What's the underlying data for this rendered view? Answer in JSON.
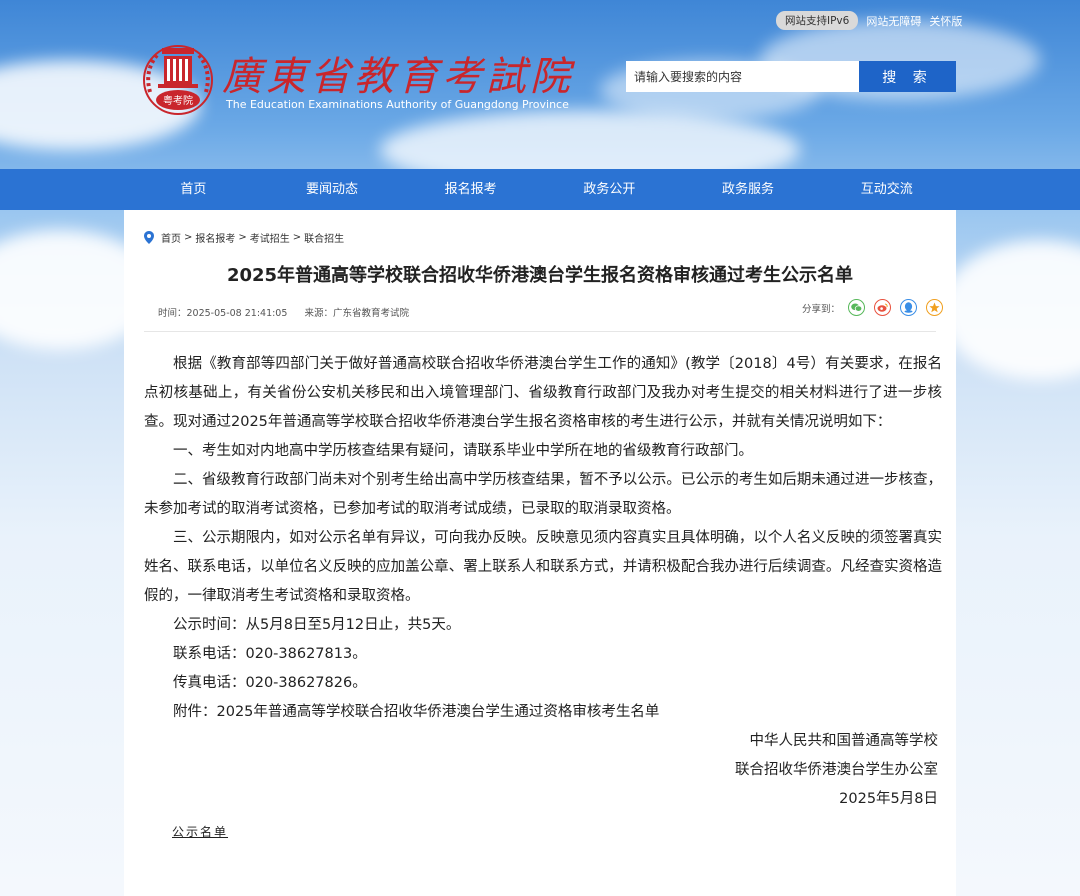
{
  "header": {
    "ipv6_badge": "网站支持IPv6",
    "accessibility_link": "网站无障碍",
    "care_mode_link": "关怀版",
    "logo_cn": "廣東省教育考試院",
    "logo_en": "The Education Examinations Authority of Guangdong Province",
    "emblem_text": "粤考院"
  },
  "search": {
    "placeholder": "请输入要搜索的内容",
    "button_label": "搜  索"
  },
  "nav": {
    "items": [
      "首页",
      "要闻动态",
      "报名报考",
      "政务公开",
      "政务服务",
      "互动交流"
    ]
  },
  "breadcrumb": [
    "首页",
    "报名报考",
    "考试招生",
    "联合招生"
  ],
  "breadcrumb_sep": ">",
  "article": {
    "title": "2025年普通高等学校联合招收华侨港澳台学生报名资格审核通过考生公示名单",
    "time": "时间：2025-05-08 21:41:05",
    "source": "来源：广东省教育考试院",
    "share_label": "分享到：",
    "paragraphs": [
      "根据《教育部等四部门关于做好普通高校联合招收华侨港澳台学生工作的通知》(教学〔2018〕4号）有关要求，在报名点初核基础上，有关省份公安机关移民和出入境管理部门、省级教育行政部门及我办对考生提交的相关材料进行了进一步核查。现对通过2025年普通高等学校联合招收华侨港澳台学生报名资格审核的考生进行公示，并就有关情况说明如下：",
      "一、考生如对内地高中学历核查结果有疑问，请联系毕业中学所在地的省级教育行政部门。",
      "二、省级教育行政部门尚未对个别考生给出高中学历核查结果，暂不予以公示。已公示的考生如后期未通过进一步核查，未参加考试的取消考试资格，已参加考试的取消考试成绩，已录取的取消录取资格。",
      "三、公示期限内，如对公示名单有异议，可向我办反映。反映意见须内容真实且具体明确，以个人名义反映的须签署真实姓名、联系电话，以单位名义反映的应加盖公章、署上联系人和联系方式，并请积极配合我办进行后续调查。凡经查实资格造假的，一律取消考生考试资格和录取资格。",
      "公示时间：从5月8日至5月12日止，共5天。",
      "联系电话：020-38627813。",
      "传真电话：020-38627826。",
      "附件：2025年普通高等学校联合招收华侨港澳台学生通过资格审核考生名单"
    ],
    "signature": [
      "中华人民共和国普通高等学校",
      "联合招收华侨港澳台学生办公室",
      "2025年5月8日"
    ],
    "attachment_link": "公示名单"
  },
  "colors": {
    "nav_blue": "#2b73d3",
    "search_button": "#1e64c8",
    "logo_red": "#c9262c"
  }
}
